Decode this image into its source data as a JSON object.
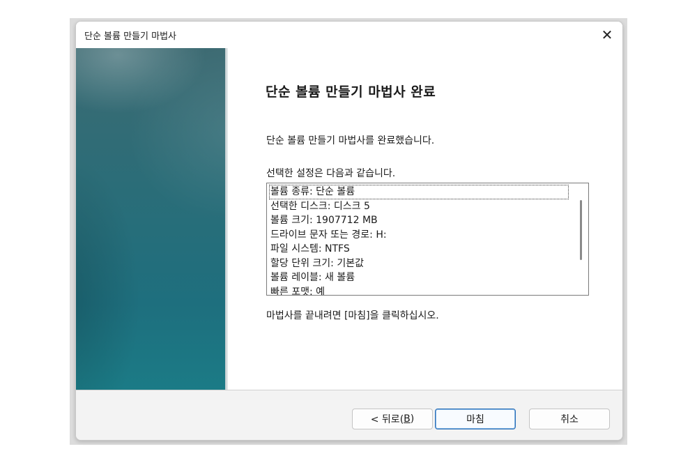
{
  "window": {
    "title": "단순 볼륨 만들기 마법사",
    "close_glyph": "✕"
  },
  "content": {
    "heading": "단순 볼륨 만들기 마법사 완료",
    "completed_text": "단순 볼륨 만들기 마법사를 완료했습니다.",
    "settings_intro": "선택한 설정은 다음과 같습니다.",
    "settings_list": [
      "볼륨 종류: 단순 볼륨",
      "선택한 디스크: 디스크 5",
      "볼륨 크기: 1907712 MB",
      "드라이브 문자 또는 경로: H:",
      "파일 시스템: NTFS",
      "할당 단위 크기: 기본값",
      "볼륨 레이블: 새 볼륨",
      "빠른 포맷: 예"
    ],
    "finish_instruction": "마법사를 끝내려면 [마침]을 클릭하십시오."
  },
  "buttons": {
    "back_prefix": "< 뒤로(",
    "back_key": "B",
    "back_suffix": ")",
    "finish": "마침",
    "cancel": "취소"
  },
  "colors": {
    "banner": "#2b6d78",
    "primary_border": "#2b6fb8"
  }
}
